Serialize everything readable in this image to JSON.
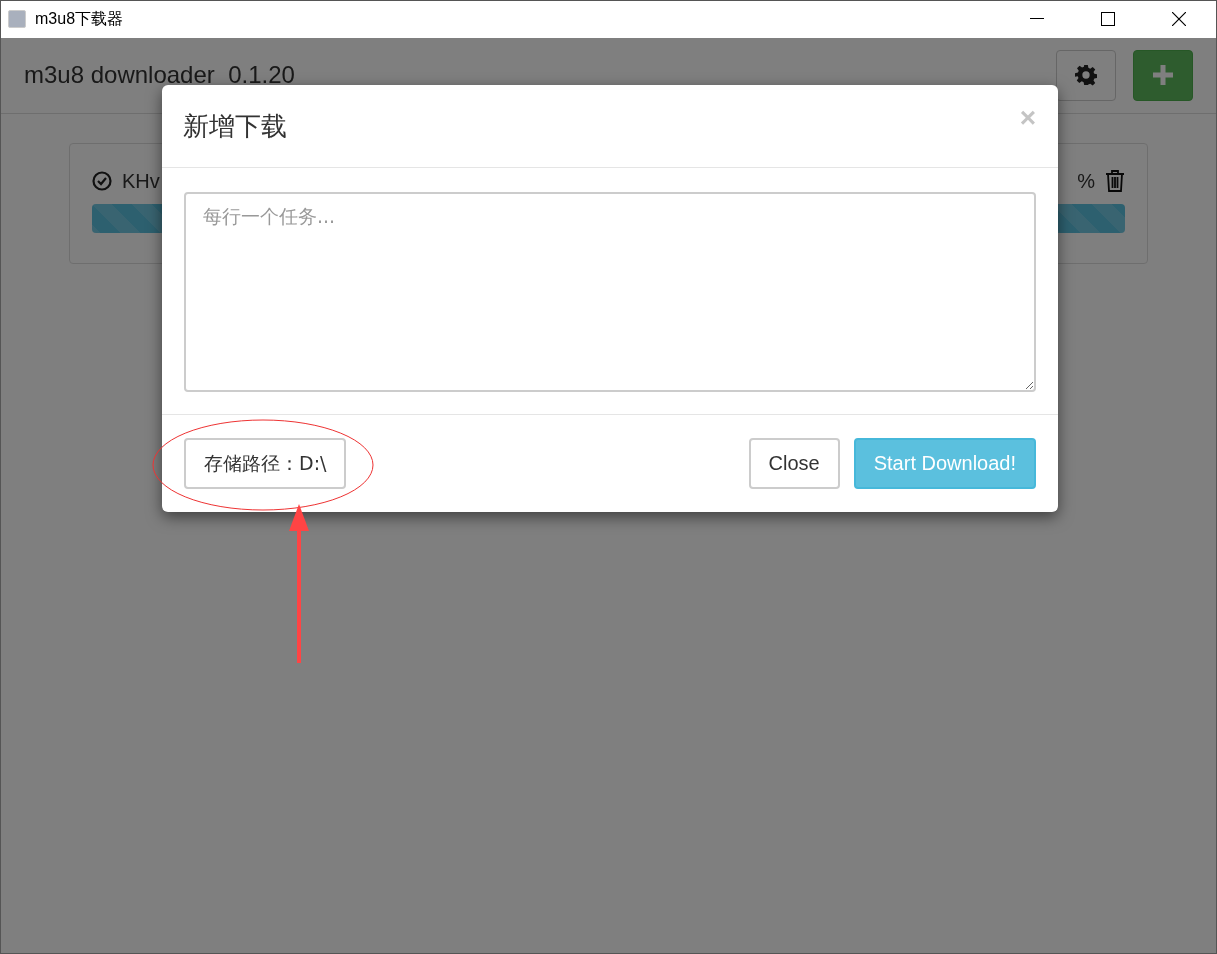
{
  "window": {
    "title": "m3u8下载器"
  },
  "header": {
    "title": "m3u8 downloader  0.1.20"
  },
  "tasks": [
    {
      "name": "KHv",
      "done": true,
      "percent": "%",
      "level": 1
    }
  ],
  "dialog": {
    "title": "新增下载",
    "close": "×",
    "textarea": {
      "placeholder": "每行一个任务..."
    },
    "path_button": "存储路径：D:\\",
    "buttons": [
      {
        "label": "Close",
        "kind": "default"
      },
      {
        "label": "Start Download!",
        "kind": "primary"
      }
    ]
  }
}
